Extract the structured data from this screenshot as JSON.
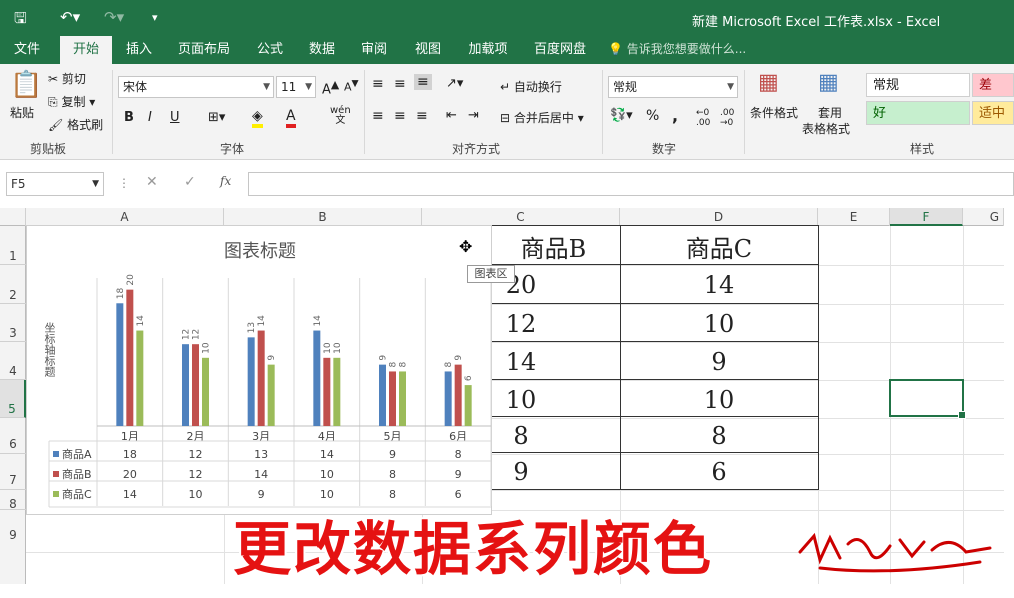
{
  "titlebar": {
    "title": "新建 Microsoft Excel 工作表.xlsx - Excel",
    "save_icon": "save-icon",
    "undo_icon": "undo-icon",
    "redo_icon": "redo-icon"
  },
  "tabs": [
    "文件",
    "开始",
    "插入",
    "页面布局",
    "公式",
    "数据",
    "审阅",
    "视图",
    "加载项",
    "百度网盘"
  ],
  "tell_me": "告诉我您想要做什么...",
  "ribbon": {
    "clipboard": {
      "paste": "粘贴",
      "cut": "剪切",
      "copy": "复制",
      "painter": "格式刷",
      "label": "剪贴板"
    },
    "font": {
      "name": "宋体",
      "size": "11",
      "bold": "B",
      "italic": "I",
      "underline": "U",
      "wen": "wén",
      "label": "字体"
    },
    "align": {
      "wrap": "自动换行",
      "merge": "合并后居中",
      "label": "对齐方式"
    },
    "number": {
      "format": "常规",
      "percent": "%",
      "comma": ",",
      "label": "数字"
    },
    "styles": {
      "conditional": "条件格式",
      "table_fmt_1": "套用",
      "table_fmt_2": "表格格式",
      "normal": "常规",
      "bad": "差",
      "good": "好",
      "neutral": "适中",
      "label": "样式"
    }
  },
  "formula": {
    "namebox": "F5",
    "cancel": "✕",
    "enter": "✓",
    "fx": "fx"
  },
  "columns": [
    "A",
    "B",
    "C",
    "D",
    "E",
    "F",
    "G"
  ],
  "rows": [
    "1",
    "2",
    "3",
    "4",
    "5",
    "6",
    "7",
    "8",
    "9"
  ],
  "table": {
    "header_b": "商品B",
    "header_c": "商品C",
    "col_b": [
      "20",
      "12",
      "14",
      "10",
      "8",
      "9"
    ],
    "col_c": [
      "14",
      "10",
      "9",
      "10",
      "8",
      "6"
    ]
  },
  "tooltip": "图表区",
  "chart_data": {
    "type": "bar",
    "title": "图表标题",
    "ylabel": "坐标轴标题",
    "categories": [
      "1月",
      "2月",
      "3月",
      "4月",
      "5月",
      "6月"
    ],
    "series": [
      {
        "name": "商品A",
        "values": [
          18,
          12,
          13,
          14,
          9,
          8
        ],
        "color": "#4f81bd"
      },
      {
        "name": "商品B",
        "values": [
          20,
          12,
          14,
          10,
          8,
          9
        ],
        "color": "#c0504d"
      },
      {
        "name": "商品C",
        "values": [
          14,
          10,
          9,
          10,
          8,
          6
        ],
        "color": "#9bbb59"
      }
    ],
    "ylim": [
      0,
      22
    ],
    "data_table": true
  },
  "caption": "更改数据系列颜色",
  "signature_text": "签名",
  "colors": {
    "accent": "#217346",
    "caption": "#e51212"
  }
}
